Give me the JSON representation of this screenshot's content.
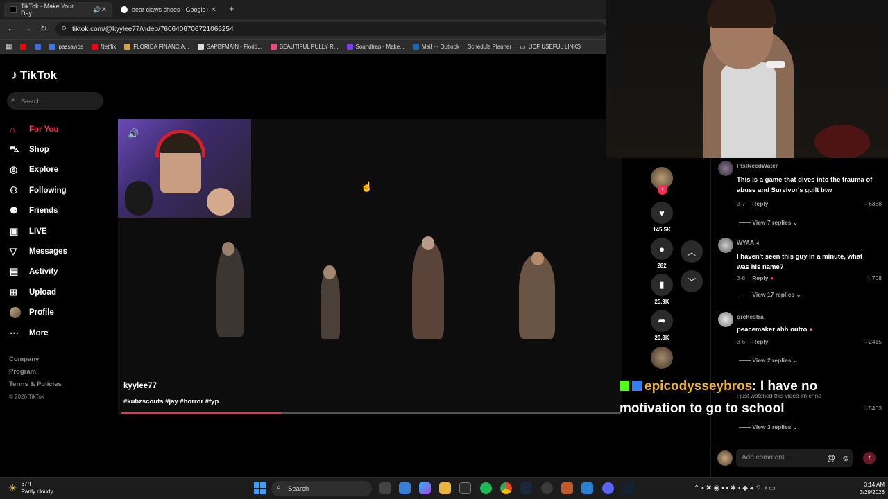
{
  "browser": {
    "tabs": [
      {
        "title": "TikTok - Make Your Day",
        "active": true
      },
      {
        "title": "bear claws shoes - Google Sear",
        "active": false
      }
    ],
    "url": "tiktok.com/@kyylee77/video/7606406706721066254",
    "bookmarks": [
      "passawds",
      "Netflix",
      "FLORIDA FINANCIA...",
      "SAPBFMAIN - Florid...",
      "BEAUTIFUL FULLY R...",
      "Soundtrap - Make...",
      "Mail - - Outlook",
      "Schedule Planner",
      "UCF USEFUL LINKS"
    ]
  },
  "sidebar": {
    "logo": "TikTok",
    "search_placeholder": "Search",
    "items": [
      {
        "label": "For You",
        "icon": "home-icon",
        "active": true
      },
      {
        "label": "Shop",
        "icon": "shop-icon"
      },
      {
        "label": "Explore",
        "icon": "compass-icon"
      },
      {
        "label": "Following",
        "icon": "following-icon"
      },
      {
        "label": "Friends",
        "icon": "friends-icon"
      },
      {
        "label": "LIVE",
        "icon": "live-icon"
      },
      {
        "label": "Messages",
        "icon": "messages-icon"
      },
      {
        "label": "Activity",
        "icon": "activity-icon"
      },
      {
        "label": "Upload",
        "icon": "upload-icon"
      },
      {
        "label": "Profile",
        "icon": "avatar"
      },
      {
        "label": "More",
        "icon": "more-icon"
      }
    ],
    "footer": [
      "Company",
      "Program",
      "Terms & Policies"
    ],
    "copyright": "© 2026 TikTok"
  },
  "video": {
    "creator": "kyylee77",
    "tags": "#kubzscouts #jay #horror #fyp",
    "progress": 0.32
  },
  "actions": {
    "likes": "145.5K",
    "comments": "282",
    "saves": "25.9K",
    "shares": "20.3K"
  },
  "comments": [
    {
      "user": "PlsINeedWater",
      "text": "This is a game that dives into the trauma of abuse and Survivor's guilt btw",
      "date": "3-7",
      "reply": "Reply",
      "likes": "6388",
      "view": "View 7 replies"
    },
    {
      "user": "WYAA",
      "text": "I haven't seen this guy in a minute, what was his name?",
      "date": "3-6",
      "reply": "Reply",
      "likes": "708",
      "view": "View 17 replies"
    },
    {
      "user": "orchestra",
      "text": "peacemaker ahh outro",
      "date": "3-6",
      "reply": "Reply",
      "likes": "2415",
      "view": "View 2 replies"
    },
    {
      "user": "",
      "text": "i just watched this video im crine",
      "date": "",
      "reply": "",
      "likes": "5403",
      "view": "View 3 replies"
    }
  ],
  "add_comment_placeholder": "Add comment...",
  "chat_overlay": {
    "username": "epicodysseybros",
    "message": ": I have no motivation to go to school"
  },
  "taskbar": {
    "temp": "67°F",
    "weather": "Partly cloudy",
    "search": "Search",
    "time": "3:14 AM",
    "date": "3/29/2026"
  },
  "colors": {
    "accent": "#fe2c55",
    "chat_name": "#f0b32a"
  }
}
